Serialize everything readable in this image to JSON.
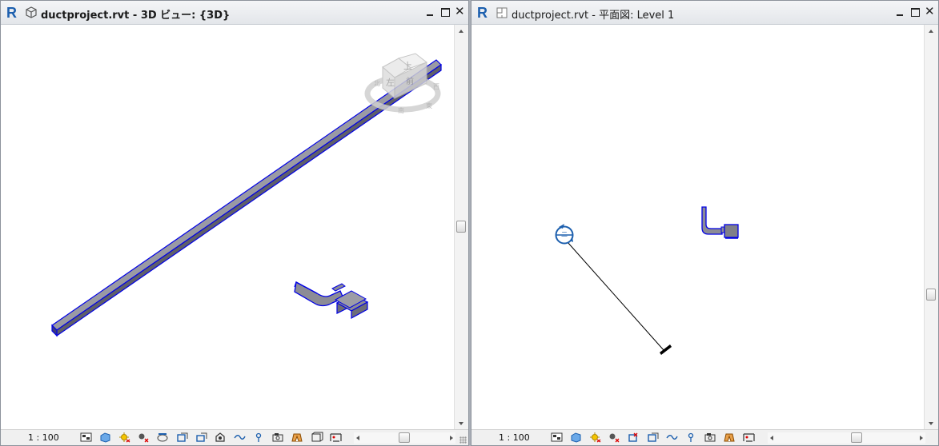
{
  "app": {
    "name": "Revit",
    "accent": "#1c5fae",
    "duct_color": "#0000e6",
    "duct_fill": "#8c8c96"
  },
  "views": [
    {
      "id": "3d",
      "file": "ductproject.rvt",
      "title_suffix": " - 3D ビュー: {3D}",
      "title_bold": true,
      "view_icon": "3d-view-icon",
      "scale": "1 : 100",
      "viewcube": {
        "top": "上",
        "left": "左",
        "front": "前",
        "compass": [
          "北",
          "東",
          "南",
          "西"
        ]
      },
      "controls": [
        "close-button",
        "maximize-button",
        "minimize-button"
      ]
    },
    {
      "id": "plan",
      "file": "ductproject.rvt",
      "title_suffix": " - 平面図: Level 1",
      "title_bold": false,
      "view_icon": "floor-plan-icon",
      "scale": "1 : 100",
      "section_tag": "二",
      "controls": [
        "close-button",
        "maximize-button",
        "minimize-button"
      ]
    }
  ],
  "view_control_tools": [
    "detail-level-icon",
    "visual-style-icon",
    "sun-path-icon",
    "shadows-icon",
    "crop-view-icon",
    "show-crop-icon",
    "unlock-3d-icon",
    "temporary-hide-icon",
    "reveal-hidden-icon",
    "worksharing-display-icon",
    "analytical-model-icon",
    "highlight-displacement-icon",
    "reveal-constraints-icon",
    "render-dialog-icon"
  ]
}
